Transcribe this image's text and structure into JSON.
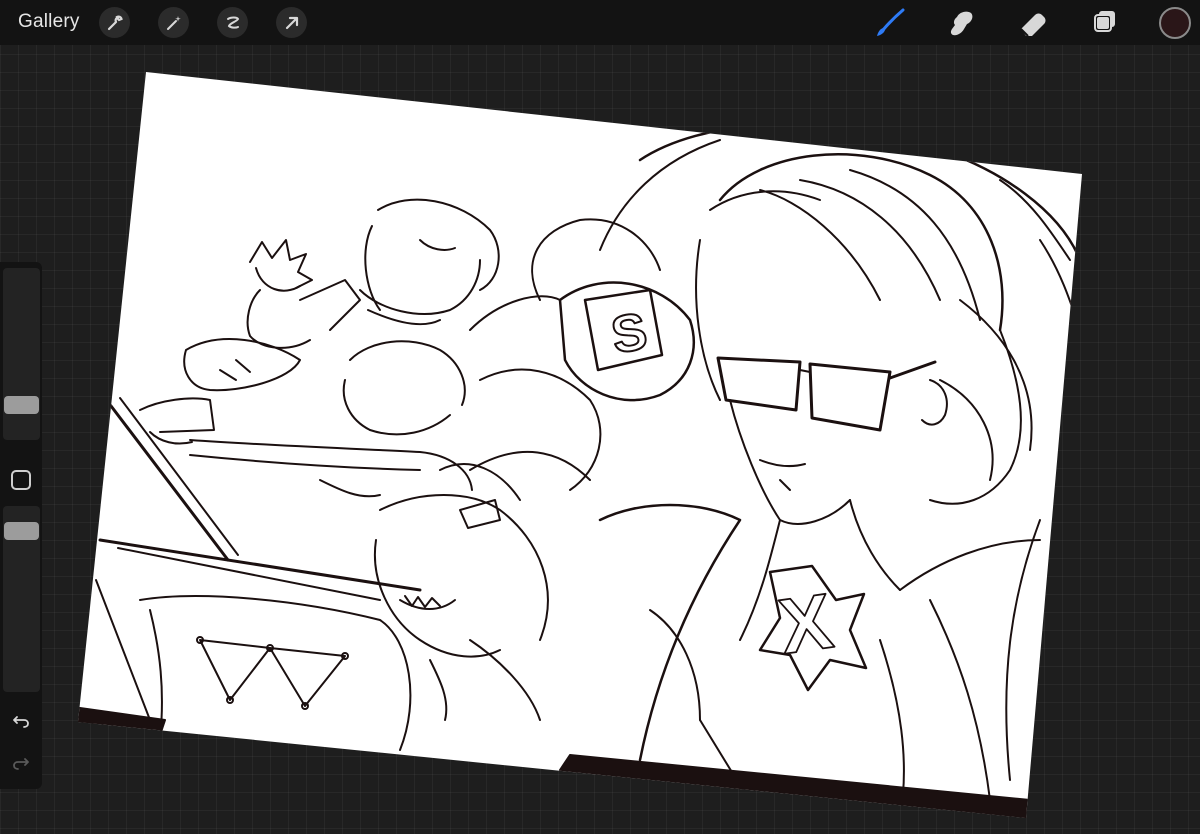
{
  "toolbar": {
    "gallery_label": "Gallery",
    "left_tools": [
      "wrench-icon",
      "magic-wand-icon",
      "selection-icon",
      "move-arrow-icon"
    ],
    "right_tools": [
      "brush-icon",
      "smudge-icon",
      "eraser-icon",
      "layers-icon"
    ],
    "active_tool": "brush-icon",
    "accent_color": "#2e7bf6",
    "current_color": "#2a1618"
  },
  "sidebar": {
    "brush_size_level": 0.25,
    "opacity_level": 0.95,
    "undo_icon": "undo-icon",
    "redo_icon": "redo-icon"
  },
  "canvas": {
    "artwork": "line-art",
    "ink_color": "#1b1010",
    "paper_color": "#ffffff",
    "badge_letter": "S",
    "emblem_letter": "X"
  }
}
